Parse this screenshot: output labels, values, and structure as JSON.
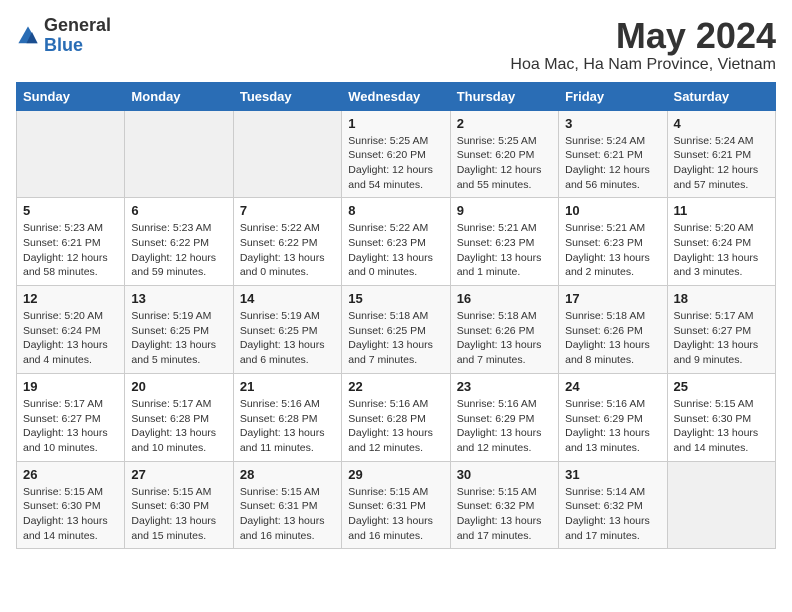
{
  "logo": {
    "text_general": "General",
    "text_blue": "Blue"
  },
  "title": {
    "month_year": "May 2024",
    "location": "Hoa Mac, Ha Nam Province, Vietnam"
  },
  "headers": [
    "Sunday",
    "Monday",
    "Tuesday",
    "Wednesday",
    "Thursday",
    "Friday",
    "Saturday"
  ],
  "weeks": [
    [
      {
        "day": "",
        "info": ""
      },
      {
        "day": "",
        "info": ""
      },
      {
        "day": "",
        "info": ""
      },
      {
        "day": "1",
        "info": "Sunrise: 5:25 AM\nSunset: 6:20 PM\nDaylight: 12 hours\nand 54 minutes."
      },
      {
        "day": "2",
        "info": "Sunrise: 5:25 AM\nSunset: 6:20 PM\nDaylight: 12 hours\nand 55 minutes."
      },
      {
        "day": "3",
        "info": "Sunrise: 5:24 AM\nSunset: 6:21 PM\nDaylight: 12 hours\nand 56 minutes."
      },
      {
        "day": "4",
        "info": "Sunrise: 5:24 AM\nSunset: 6:21 PM\nDaylight: 12 hours\nand 57 minutes."
      }
    ],
    [
      {
        "day": "5",
        "info": "Sunrise: 5:23 AM\nSunset: 6:21 PM\nDaylight: 12 hours\nand 58 minutes."
      },
      {
        "day": "6",
        "info": "Sunrise: 5:23 AM\nSunset: 6:22 PM\nDaylight: 12 hours\nand 59 minutes."
      },
      {
        "day": "7",
        "info": "Sunrise: 5:22 AM\nSunset: 6:22 PM\nDaylight: 13 hours\nand 0 minutes."
      },
      {
        "day": "8",
        "info": "Sunrise: 5:22 AM\nSunset: 6:23 PM\nDaylight: 13 hours\nand 0 minutes."
      },
      {
        "day": "9",
        "info": "Sunrise: 5:21 AM\nSunset: 6:23 PM\nDaylight: 13 hours\nand 1 minute."
      },
      {
        "day": "10",
        "info": "Sunrise: 5:21 AM\nSunset: 6:23 PM\nDaylight: 13 hours\nand 2 minutes."
      },
      {
        "day": "11",
        "info": "Sunrise: 5:20 AM\nSunset: 6:24 PM\nDaylight: 13 hours\nand 3 minutes."
      }
    ],
    [
      {
        "day": "12",
        "info": "Sunrise: 5:20 AM\nSunset: 6:24 PM\nDaylight: 13 hours\nand 4 minutes."
      },
      {
        "day": "13",
        "info": "Sunrise: 5:19 AM\nSunset: 6:25 PM\nDaylight: 13 hours\nand 5 minutes."
      },
      {
        "day": "14",
        "info": "Sunrise: 5:19 AM\nSunset: 6:25 PM\nDaylight: 13 hours\nand 6 minutes."
      },
      {
        "day": "15",
        "info": "Sunrise: 5:18 AM\nSunset: 6:25 PM\nDaylight: 13 hours\nand 7 minutes."
      },
      {
        "day": "16",
        "info": "Sunrise: 5:18 AM\nSunset: 6:26 PM\nDaylight: 13 hours\nand 7 minutes."
      },
      {
        "day": "17",
        "info": "Sunrise: 5:18 AM\nSunset: 6:26 PM\nDaylight: 13 hours\nand 8 minutes."
      },
      {
        "day": "18",
        "info": "Sunrise: 5:17 AM\nSunset: 6:27 PM\nDaylight: 13 hours\nand 9 minutes."
      }
    ],
    [
      {
        "day": "19",
        "info": "Sunrise: 5:17 AM\nSunset: 6:27 PM\nDaylight: 13 hours\nand 10 minutes."
      },
      {
        "day": "20",
        "info": "Sunrise: 5:17 AM\nSunset: 6:28 PM\nDaylight: 13 hours\nand 10 minutes."
      },
      {
        "day": "21",
        "info": "Sunrise: 5:16 AM\nSunset: 6:28 PM\nDaylight: 13 hours\nand 11 minutes."
      },
      {
        "day": "22",
        "info": "Sunrise: 5:16 AM\nSunset: 6:28 PM\nDaylight: 13 hours\nand 12 minutes."
      },
      {
        "day": "23",
        "info": "Sunrise: 5:16 AM\nSunset: 6:29 PM\nDaylight: 13 hours\nand 12 minutes."
      },
      {
        "day": "24",
        "info": "Sunrise: 5:16 AM\nSunset: 6:29 PM\nDaylight: 13 hours\nand 13 minutes."
      },
      {
        "day": "25",
        "info": "Sunrise: 5:15 AM\nSunset: 6:30 PM\nDaylight: 13 hours\nand 14 minutes."
      }
    ],
    [
      {
        "day": "26",
        "info": "Sunrise: 5:15 AM\nSunset: 6:30 PM\nDaylight: 13 hours\nand 14 minutes."
      },
      {
        "day": "27",
        "info": "Sunrise: 5:15 AM\nSunset: 6:30 PM\nDaylight: 13 hours\nand 15 minutes."
      },
      {
        "day": "28",
        "info": "Sunrise: 5:15 AM\nSunset: 6:31 PM\nDaylight: 13 hours\nand 16 minutes."
      },
      {
        "day": "29",
        "info": "Sunrise: 5:15 AM\nSunset: 6:31 PM\nDaylight: 13 hours\nand 16 minutes."
      },
      {
        "day": "30",
        "info": "Sunrise: 5:15 AM\nSunset: 6:32 PM\nDaylight: 13 hours\nand 17 minutes."
      },
      {
        "day": "31",
        "info": "Sunrise: 5:14 AM\nSunset: 6:32 PM\nDaylight: 13 hours\nand 17 minutes."
      },
      {
        "day": "",
        "info": ""
      }
    ]
  ]
}
